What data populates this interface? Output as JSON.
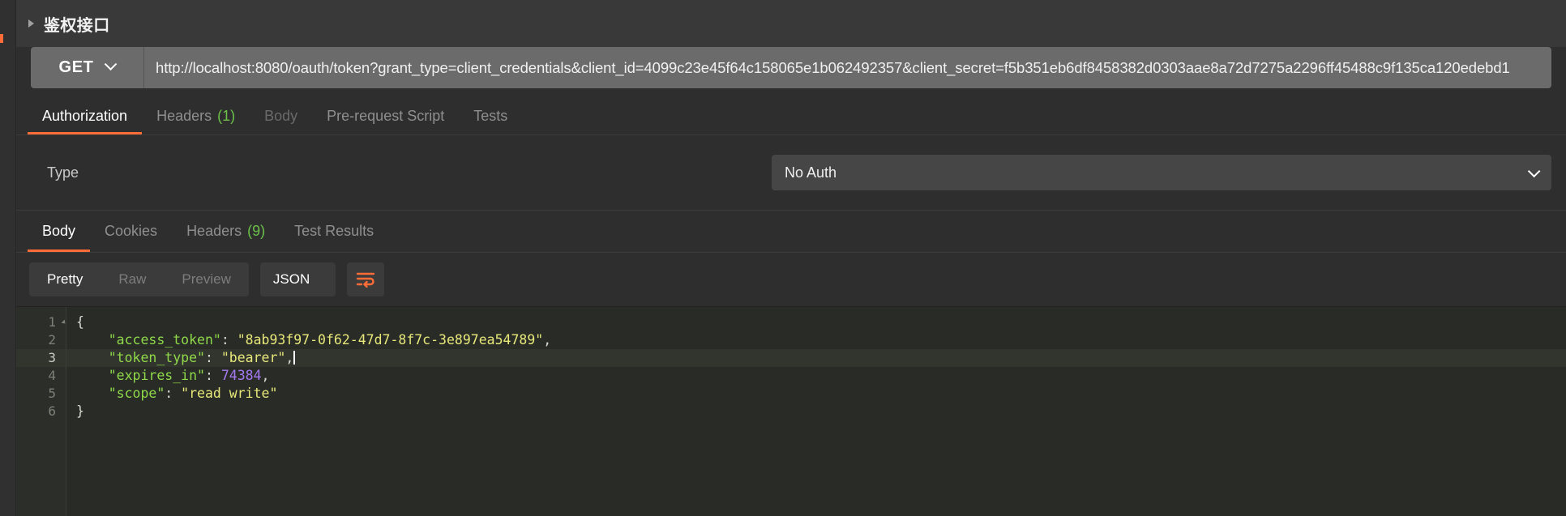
{
  "window": {
    "request_title": "鉴权接口",
    "disclosure_icon": "triangle-right-icon"
  },
  "url_bar": {
    "method": "GET",
    "method_chevron_icon": "chevron-down-icon",
    "url": "http://localhost:8080/oauth/token?grant_type=client_credentials&client_id=4099c23e45f64c158065e1b062492357&client_secret=f5b351eb6df8458382d0303aae8a72d7275a2296ff45488c9f135ca120edebd1"
  },
  "request_tabs": [
    {
      "label": "Authorization",
      "count": "",
      "state": "active"
    },
    {
      "label": "Headers",
      "count": "(1)",
      "state": "normal"
    },
    {
      "label": "Body",
      "count": "",
      "state": "disabled"
    },
    {
      "label": "Pre-request Script",
      "count": "",
      "state": "normal"
    },
    {
      "label": "Tests",
      "count": "",
      "state": "normal"
    }
  ],
  "authorization": {
    "type_label": "Type",
    "selected_type": "No Auth",
    "chevron_icon": "chevron-down-icon"
  },
  "response_tabs": [
    {
      "label": "Body",
      "count": "",
      "state": "active"
    },
    {
      "label": "Cookies",
      "count": "",
      "state": "normal"
    },
    {
      "label": "Headers",
      "count": "(9)",
      "state": "normal"
    },
    {
      "label": "Test Results",
      "count": "",
      "state": "normal"
    }
  ],
  "format_toolbar": {
    "views": [
      {
        "label": "Pretty",
        "state": "active"
      },
      {
        "label": "Raw",
        "state": "normal"
      },
      {
        "label": "Preview",
        "state": "normal"
      }
    ],
    "language": "JSON",
    "language_chevron_icon": "chevron-down-icon",
    "wrap_button_icon": "word-wrap-icon"
  },
  "response_body": {
    "line_numbers": [
      "1",
      "2",
      "3",
      "4",
      "5",
      "6"
    ],
    "current_line": 3,
    "lines": [
      {
        "n": "1",
        "tokens": [
          {
            "t": "{",
            "c": "pun"
          }
        ]
      },
      {
        "n": "2",
        "tokens": [
          {
            "t": "    ",
            "c": "pun"
          },
          {
            "t": "\"access_token\"",
            "c": "key"
          },
          {
            "t": ": ",
            "c": "pun"
          },
          {
            "t": "\"8ab93f97-0f62-47d7-8f7c-3e897ea54789\"",
            "c": "str"
          },
          {
            "t": ",",
            "c": "pun"
          }
        ]
      },
      {
        "n": "3",
        "tokens": [
          {
            "t": "    ",
            "c": "pun"
          },
          {
            "t": "\"token_type\"",
            "c": "key"
          },
          {
            "t": ": ",
            "c": "pun"
          },
          {
            "t": "\"bearer\"",
            "c": "str"
          },
          {
            "t": ",",
            "c": "pun"
          }
        ]
      },
      {
        "n": "4",
        "tokens": [
          {
            "t": "    ",
            "c": "pun"
          },
          {
            "t": "\"expires_in\"",
            "c": "key"
          },
          {
            "t": ": ",
            "c": "pun"
          },
          {
            "t": "74384",
            "c": "num"
          },
          {
            "t": ",",
            "c": "pun"
          }
        ]
      },
      {
        "n": "5",
        "tokens": [
          {
            "t": "    ",
            "c": "pun"
          },
          {
            "t": "\"scope\"",
            "c": "key"
          },
          {
            "t": ": ",
            "c": "pun"
          },
          {
            "t": "\"read write\"",
            "c": "str"
          }
        ]
      },
      {
        "n": "6",
        "tokens": [
          {
            "t": "}",
            "c": "pun"
          }
        ]
      }
    ]
  },
  "colors": {
    "accent_orange": "#ff6c37",
    "count_green": "#6cc04a",
    "json_key": "#8fd94a",
    "json_string": "#e8e87a",
    "json_number": "#a579f0",
    "editor_bg": "#282b26"
  }
}
